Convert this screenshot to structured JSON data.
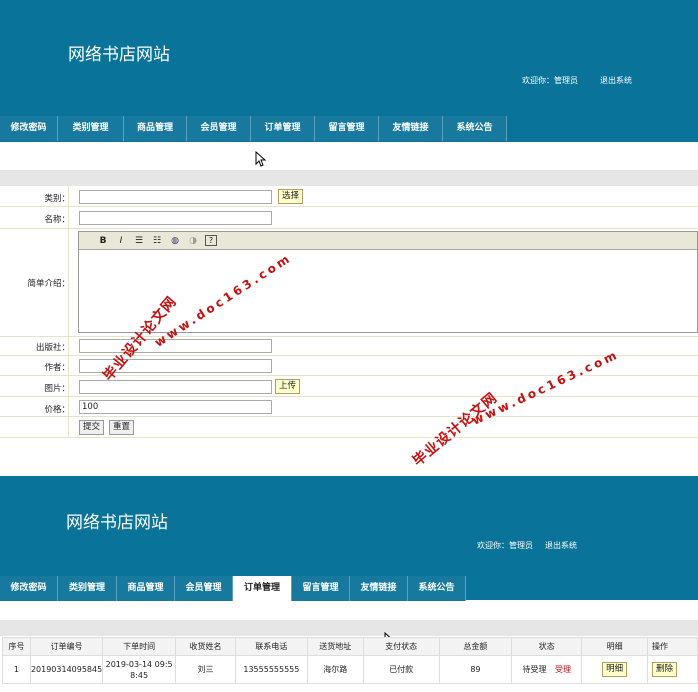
{
  "top": {
    "site_title": "网络书店网站",
    "welcome": "欢迎你：管理员",
    "logout": "退出系统",
    "nav": [
      "修改密码",
      "类别管理",
      "商品管理",
      "会员管理",
      "订单管理",
      "留言管理",
      "友情链接",
      "系统公告"
    ]
  },
  "form": {
    "category_label": "类别：",
    "category_value": "",
    "choose_button": "选择",
    "name_label": "名称：",
    "name_value": "",
    "intro_label": "简单介绍：",
    "publisher_label": "出版社：",
    "author_label": "作者：",
    "image_label": "图片：",
    "upload_button": "上传",
    "price_label": "价格：",
    "price_value": "100",
    "submit_button": "提交",
    "reset_button": "重置",
    "toolbar": [
      "B",
      "I",
      "☰",
      "☷",
      "◍",
      "◑",
      "?"
    ]
  },
  "watermarks": {
    "text1": "毕业设计论文网",
    "url1": "www.doc163.com",
    "text2": "毕业设计论文网",
    "url2": "www.doc163.com"
  },
  "bottom": {
    "site_title": "网络书店网站",
    "welcome": "欢迎你：管理员",
    "logout": "退出系统",
    "nav": [
      "修改密码",
      "类别管理",
      "商品管理",
      "会员管理",
      "订单管理",
      "留言管理",
      "友情链接",
      "系统公告"
    ],
    "active_tab": 4,
    "table": {
      "headers": [
        "序号",
        "订单编号",
        "下单时间",
        "收货姓名",
        "联系电话",
        "送货地址",
        "支付状态",
        "总金额",
        "状态",
        "明细",
        "操作"
      ],
      "rows": [
        {
          "no": "1",
          "order_id": "20190314095845",
          "time_line1": "2019-03-14 09:5",
          "time_line2": "8:45",
          "name": "刘三",
          "phone": "13555555555",
          "address": "海尔路",
          "pay_status": "已付款",
          "total": "89",
          "status": "待受理",
          "action_accept": "受理",
          "detail": "明细",
          "delete": "删除"
        }
      ]
    }
  },
  "colors": {
    "header_bg": "#0a739a",
    "accent_red": "#c41010",
    "button_yellow": "#ffffcc"
  }
}
